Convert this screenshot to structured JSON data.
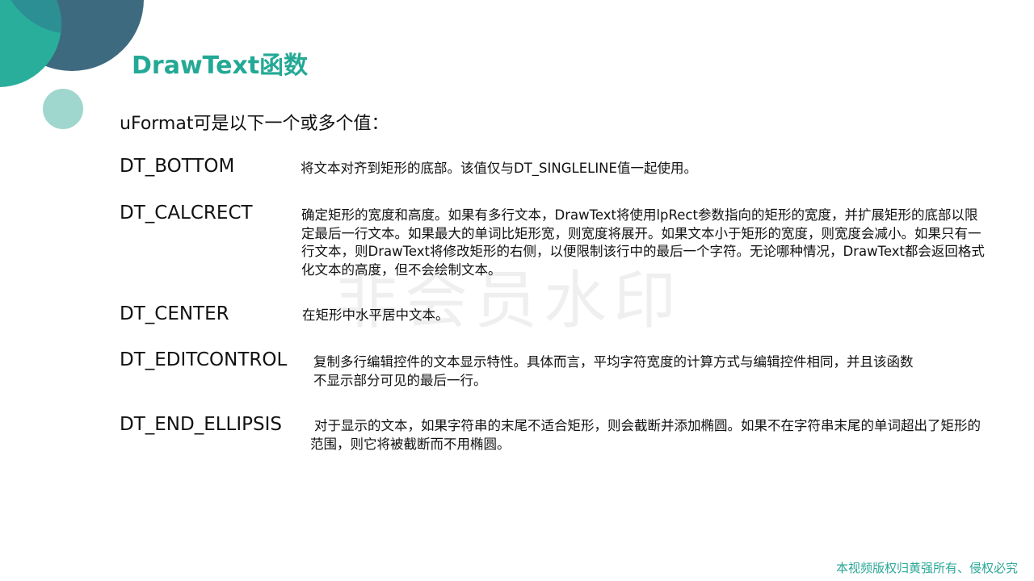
{
  "slide": {
    "title": "DrawText函数",
    "intro": "uFormat可是以下一个或多个值：",
    "items": [
      {
        "term": "DT_BOTTOM",
        "description": "将文本对齐到矩形的底部。该值仅与DT_SINGLELINE值一起使用。"
      },
      {
        "term": "DT_CALCRECT",
        "description": "确定矩形的宽度和高度。如果有多行文本，DrawText将使用lpRect参数指向的矩形的宽度，并扩展矩形的底部以限定最后一行文本。如果最大的单词比矩形宽，则宽度将展开。如果文本小于矩形的宽度，则宽度会减小。如果只有一行文本，则DrawText将修改矩形的右侧，以便限制该行中的最后一个字符。无论哪种情况，DrawText都会返回格式化文本的高度，但不会绘制文本。"
      },
      {
        "term": "DT_CENTER",
        "description": "在矩形中水平居中文本。"
      },
      {
        "term": "DT_EDITCONTROL",
        "description": "复制多行编辑控件的文本显示特性。具体而言，平均字符宽度的计算方式与编辑控件相同，并且该函数不显示部分可见的最后一行。"
      },
      {
        "term": "DT_END_ELLIPSIS",
        "description": "对于显示的文本，如果字符串的末尾不适合矩形，则会截断并添加椭圆。如果不在字符串末尾的单词超出了矩形的范围，则它将被截断而不用椭圆。"
      }
    ],
    "watermark": "非会员水印",
    "copyright": "本视频版权归黄强所有、侵权必究"
  },
  "colors": {
    "title": "#23a995",
    "deco_dark": "#3e6a80",
    "deco_teal": "#2aae9c",
    "deco_light": "#9fd6cd",
    "copyright": "#2aa796"
  }
}
